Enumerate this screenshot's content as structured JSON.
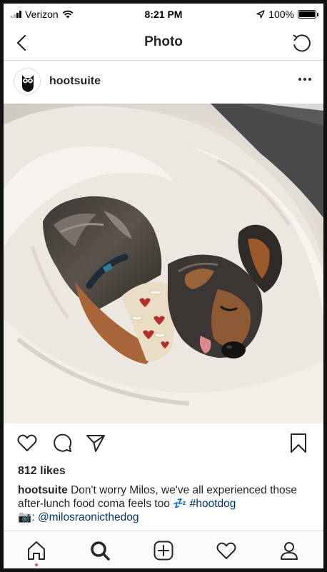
{
  "status_bar": {
    "carrier": "Verizon",
    "time": "8:21 PM",
    "battery": "100%",
    "battery_level": 1.0
  },
  "nav": {
    "title": "Photo",
    "back_icon": "chevron-left-icon",
    "refresh_icon": "refresh-icon"
  },
  "post": {
    "username": "hootsuite",
    "avatar_icon": "owl-logo",
    "more_icon": "ellipsis-icon",
    "likes": "812 likes",
    "caption": {
      "author": "hootsuite",
      "text": "Don't worry Milos, we've all experienced those after-lunch food coma feels too",
      "emoji": "💤",
      "hashtag": "#hootdog",
      "camera_emoji": "📷",
      "mention_prefix": ":",
      "mention": "@milosraonicthedog"
    }
  },
  "actions": {
    "like_icon": "heart-icon",
    "comment_icon": "comment-icon",
    "share_icon": "send-icon",
    "save_icon": "bookmark-icon"
  },
  "tabbar": {
    "items": [
      "home-icon",
      "search-icon",
      "add-icon",
      "activity-heart-icon",
      "profile-icon"
    ],
    "notification_color": "#ed4956"
  }
}
